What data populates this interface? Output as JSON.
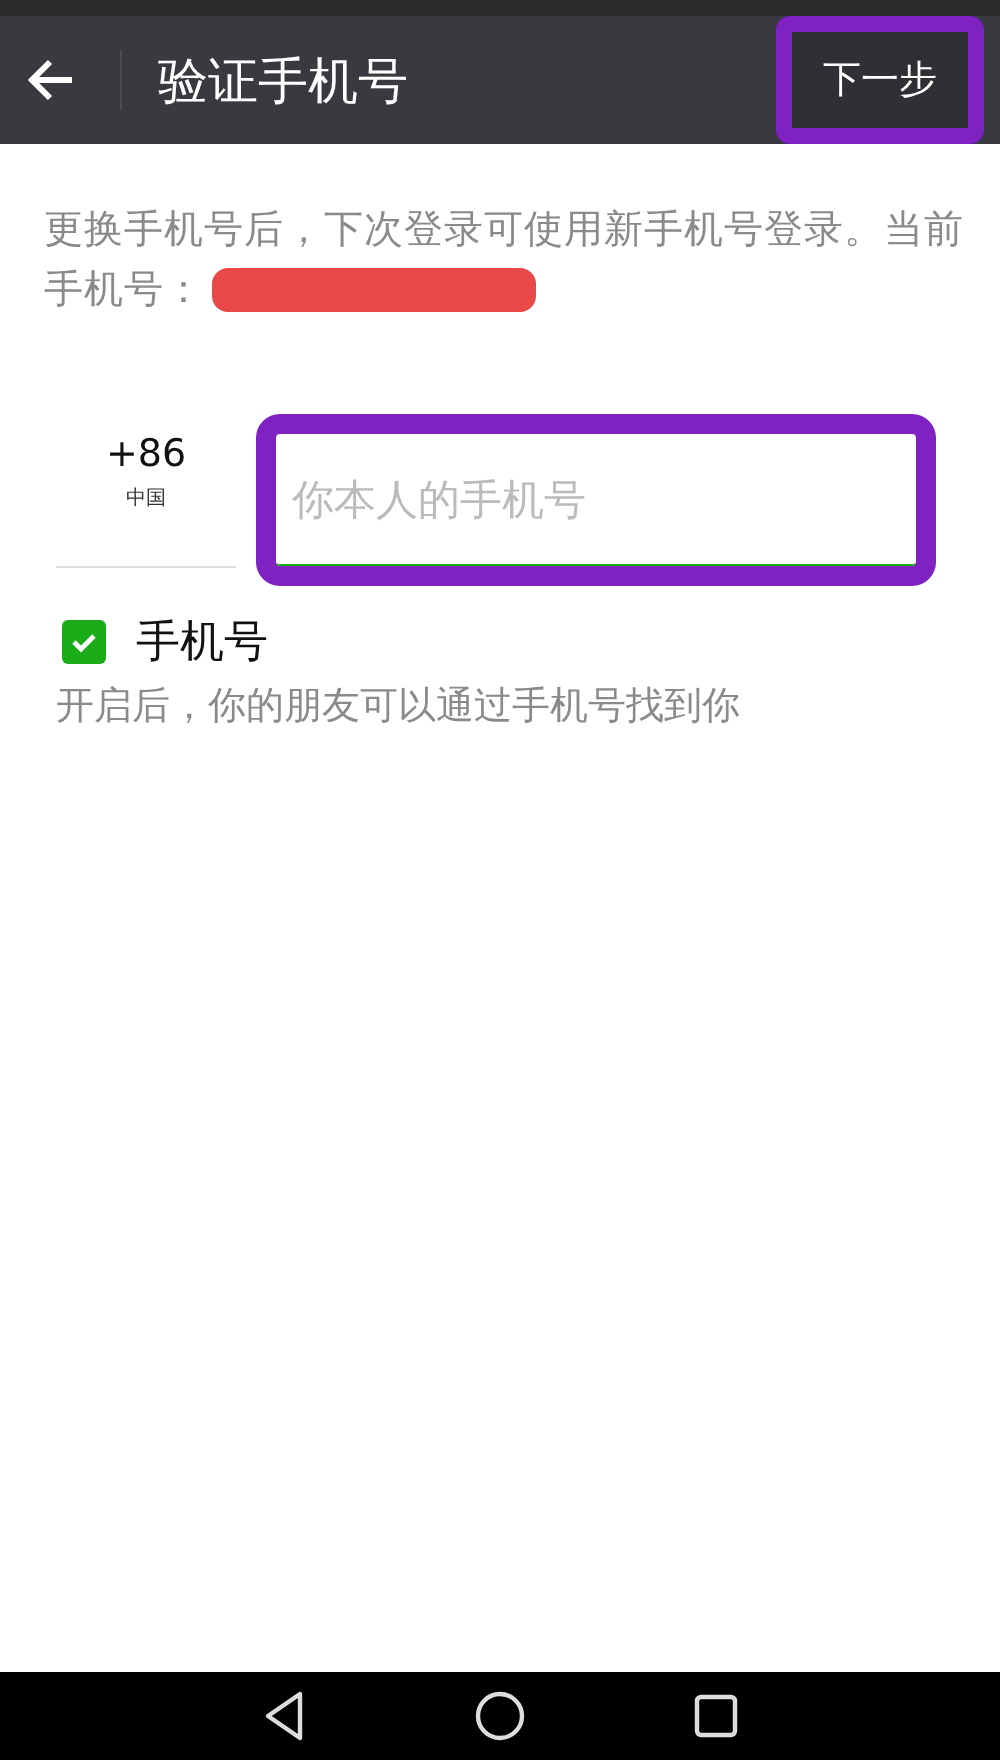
{
  "header": {
    "title": "验证手机号",
    "next_button": {
      "label": "下一步",
      "highlighted": true
    }
  },
  "notice": {
    "text": "更换手机号后，下次登录可使用新手机号登录。当前手机号：",
    "current_number_redacted": true
  },
  "phone_form": {
    "country_code": "+86",
    "country": "中国",
    "phone_field": {
      "placeholder": "你本人的手机号",
      "highlighted": true
    }
  },
  "discoverable": {
    "label": "手机号",
    "checked": true,
    "description": "开启后，你的朋友可以通过手机号找到你"
  }
}
